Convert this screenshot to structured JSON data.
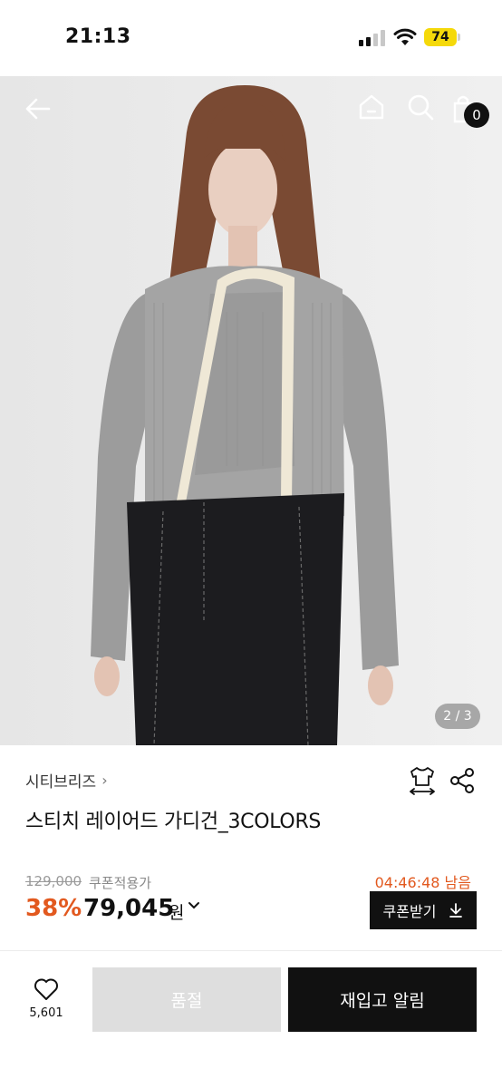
{
  "status_bar": {
    "time": "21:13",
    "battery": "74"
  },
  "header": {
    "cart_count": "0"
  },
  "hero": {
    "page_indicator": "2 / 3"
  },
  "product": {
    "brand": "시티브리즈",
    "title": "스티치 레이어드 가디건_3COLORS",
    "original_price": "129,000",
    "coupon_note": "쿠폰적용가",
    "countdown": "04:46:48 남음",
    "discount": "38%",
    "sale_price": "79,045",
    "currency": "원",
    "coupon_button": "쿠폰받기"
  },
  "bottom_bar": {
    "like_count": "5,601",
    "soldout_label": "품절",
    "restock_label": "재입고 알림"
  },
  "colors": {
    "accent": "#e2591f",
    "dark": "#111111",
    "disabled": "#dedede"
  },
  "icons": [
    "back-arrow-icon",
    "home-icon",
    "search-icon",
    "cart-icon",
    "size-guide-icon",
    "share-icon",
    "heart-icon",
    "download-icon",
    "chevron-right-icon",
    "chevron-down-icon"
  ]
}
